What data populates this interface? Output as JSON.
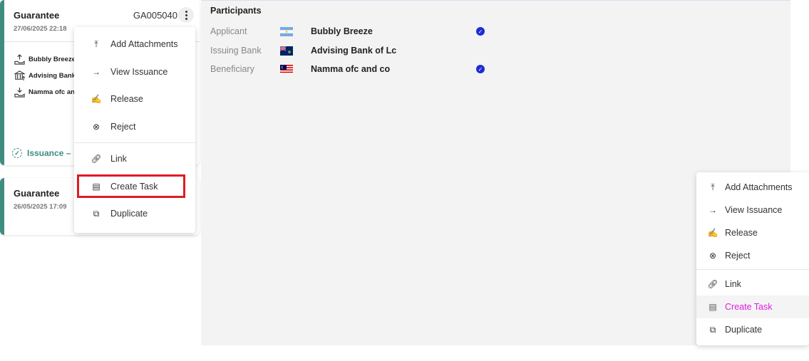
{
  "cards": [
    {
      "title": "Guarantee",
      "date": "27/06/2025 22:18",
      "id": "GA005040",
      "parties": [
        {
          "icon": "hand-upload-icon",
          "name": "Bubbly Breeze"
        },
        {
          "icon": "bank-icon",
          "name": "Advising Bank"
        },
        {
          "icon": "hand-download-icon",
          "name": "Namma ofc an"
        }
      ],
      "status": "Issuance –"
    },
    {
      "title": "Guarantee",
      "date": "26/05/2025 17:09"
    }
  ],
  "participants": {
    "title": "Participants",
    "rows": [
      {
        "label": "Applicant",
        "flag": "argentina-flag",
        "name": "Bubbly Breeze",
        "verified": true
      },
      {
        "label": "Issuing Bank",
        "flag": "falkland-islands-flag",
        "name": "Advising Bank of Lc",
        "verified": false
      },
      {
        "label": "Beneficiary",
        "flag": "malaysia-flag",
        "name": "Namma ofc and co",
        "verified": true
      }
    ]
  },
  "menu": {
    "items": [
      {
        "icon": "upload-icon",
        "label": "Add Attachments"
      },
      {
        "icon": "arrow-right-icon",
        "label": "View Issuance"
      },
      {
        "icon": "signature-icon",
        "label": "Release"
      },
      {
        "icon": "circle-x-icon",
        "label": "Reject"
      },
      {
        "icon": "link-icon",
        "label": "Link"
      },
      {
        "icon": "document-icon",
        "label": "Create Task"
      },
      {
        "icon": "copy-icon",
        "label": "Duplicate"
      }
    ]
  },
  "colors": {
    "accent": "#3f8d7e",
    "highlight": "#e01b24",
    "hover_text": "#e020e0",
    "verified": "#1e2bd6"
  }
}
